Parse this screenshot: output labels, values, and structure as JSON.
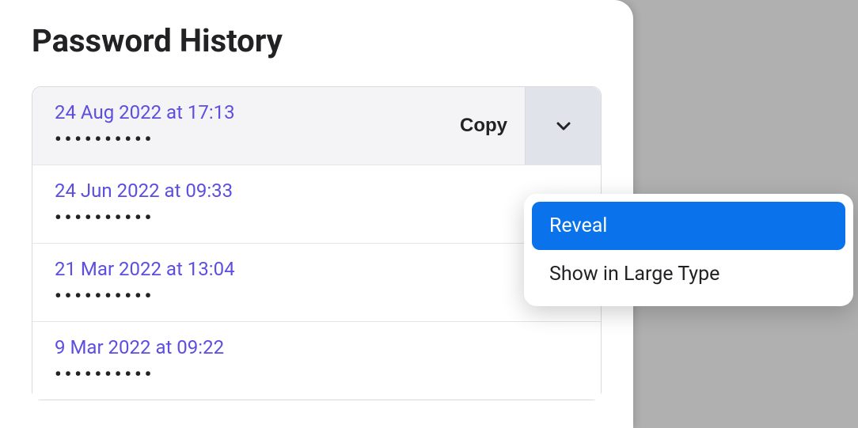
{
  "title": "Password History",
  "copy_label": "Copy",
  "entries": [
    {
      "date": "24 Aug 2022 at 17:13",
      "masked": "••••••••••"
    },
    {
      "date": "24 Jun 2022 at 09:33",
      "masked": "••••••••••"
    },
    {
      "date": "21 Mar 2022 at 13:04",
      "masked": "••••••••••"
    },
    {
      "date": "9 Mar 2022 at 09:22",
      "masked": "••••••••••"
    }
  ],
  "menu": {
    "reveal": "Reveal",
    "large_type": "Show in Large Type"
  }
}
